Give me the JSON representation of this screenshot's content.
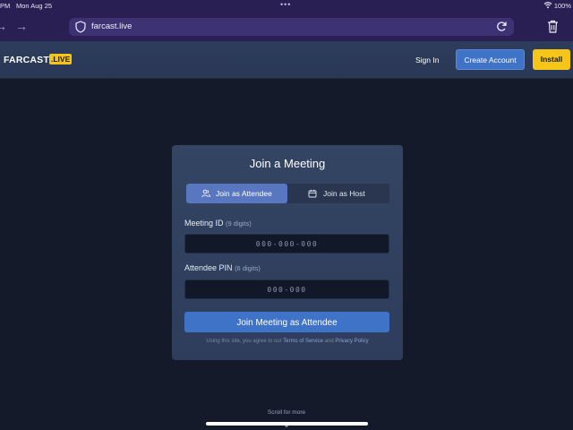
{
  "status_bar": {
    "time": "PM",
    "date": "Mon Aug 25",
    "battery": "100%"
  },
  "browser": {
    "url": "farcast.live"
  },
  "header": {
    "brand": "FARCAST",
    "brand_badge": ".LIVE",
    "sign_in": "Sign In",
    "create_account": "Create Account",
    "install": "Install"
  },
  "card": {
    "title": "Join a Meeting",
    "tabs": [
      {
        "label": "Join as Attendee",
        "selected": true
      },
      {
        "label": "Join as Host",
        "selected": false
      }
    ],
    "meeting_id": {
      "label": "Meeting ID",
      "hint": "(9 digits)",
      "placeholder": "000-000-000"
    },
    "attendee_pin": {
      "label": "Attendee PIN",
      "hint": "(6 digits)",
      "placeholder": "000-000"
    },
    "submit": "Join Meeting as Attendee",
    "legal": {
      "prefix": "Using this site, you agree to our",
      "terms": "Terms of Service",
      "and": "and",
      "privacy": "Privacy Policy"
    }
  },
  "scroll_hint": "Scroll for more",
  "colors": {
    "accent_blue": "#3f73c8",
    "accent_yellow": "#f5c518",
    "background": "#141a2a",
    "card": "#334563"
  },
  "icons": [
    "wifi-icon",
    "battery-icon",
    "back-arrow-icon",
    "forward-arrow-icon",
    "shield-icon",
    "reload-icon",
    "trash-icon",
    "users-icon",
    "calendar-icon",
    "chevron-down-icon"
  ]
}
